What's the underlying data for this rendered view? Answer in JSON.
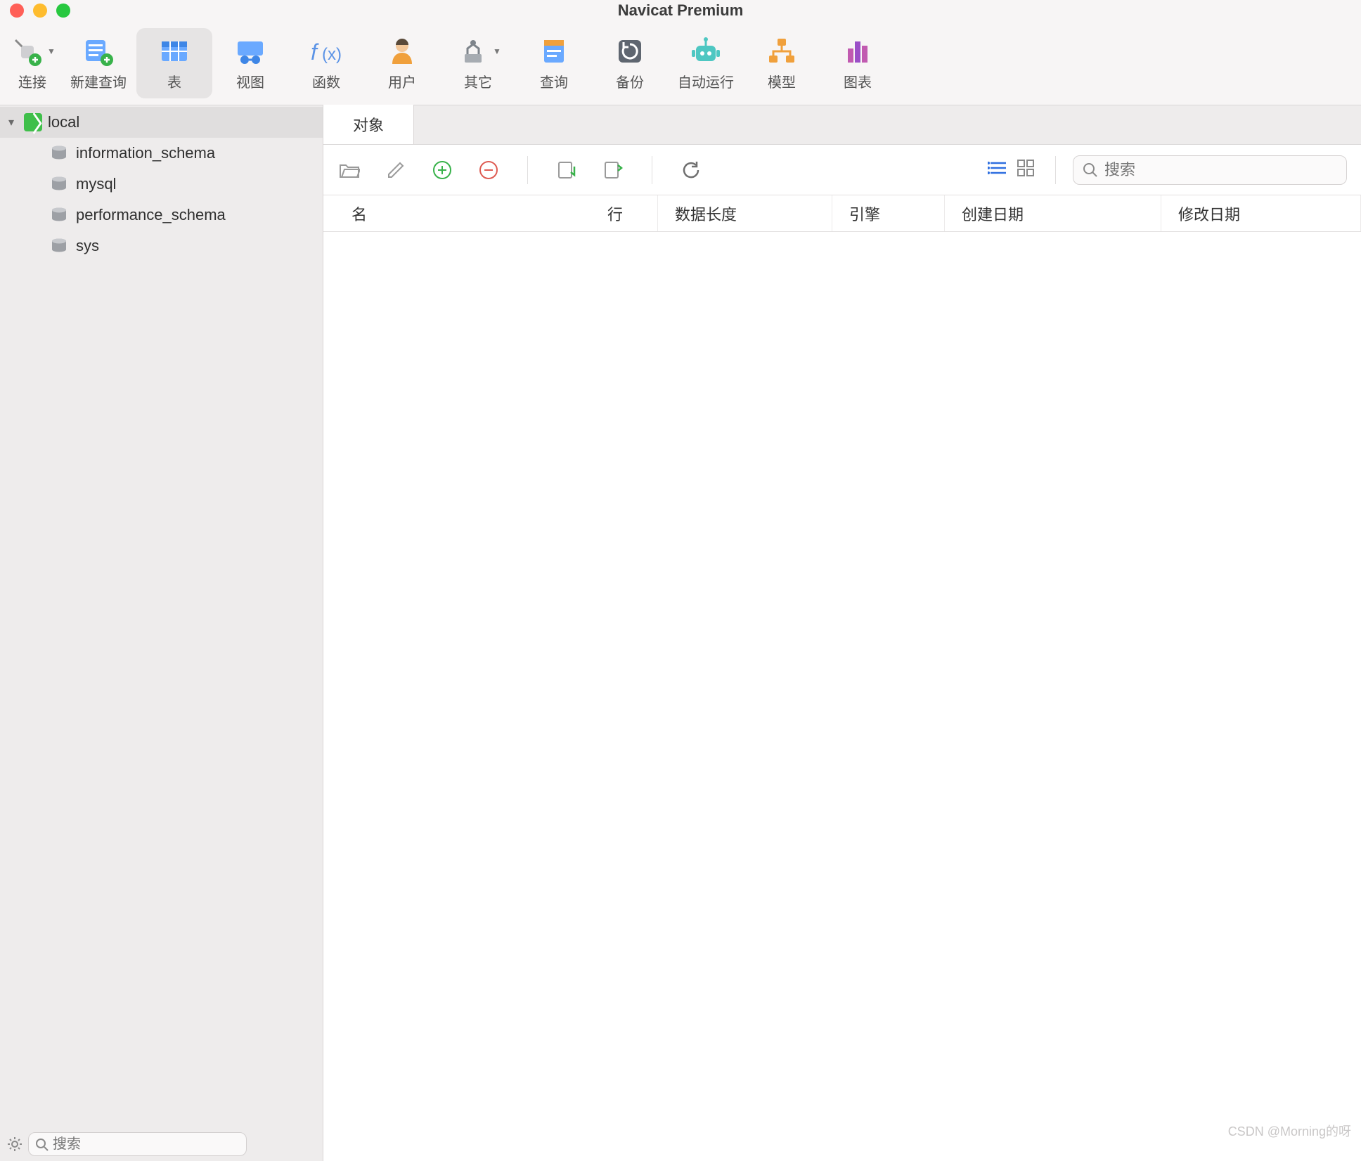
{
  "title": "Navicat Premium",
  "toolbar": [
    {
      "label": "连接",
      "icon": "plug",
      "dropdown": true
    },
    {
      "label": "新建查询",
      "icon": "newquery"
    },
    {
      "label": "表",
      "icon": "table",
      "active": true
    },
    {
      "label": "视图",
      "icon": "view"
    },
    {
      "label": "函数",
      "icon": "func"
    },
    {
      "label": "用户",
      "icon": "user"
    },
    {
      "label": "其它",
      "icon": "other",
      "dropdown": true
    },
    {
      "label": "查询",
      "icon": "query"
    },
    {
      "label": "备份",
      "icon": "backup"
    },
    {
      "label": "自动运行",
      "icon": "auto"
    },
    {
      "label": "模型",
      "icon": "model"
    },
    {
      "label": "图表",
      "icon": "chart"
    }
  ],
  "sidebar": {
    "connection": "local",
    "databases": [
      "information_schema",
      "mysql",
      "performance_schema",
      "sys"
    ],
    "search_placeholder": "搜索"
  },
  "tabs": [
    {
      "label": "对象"
    }
  ],
  "objectbar": {
    "search_placeholder": "搜索"
  },
  "columns": {
    "name": "名",
    "rows": "行",
    "len": "数据长度",
    "eng": "引擎",
    "cdate": "创建日期",
    "mdate": "修改日期"
  },
  "watermark": "CSDN @Morning的呀"
}
